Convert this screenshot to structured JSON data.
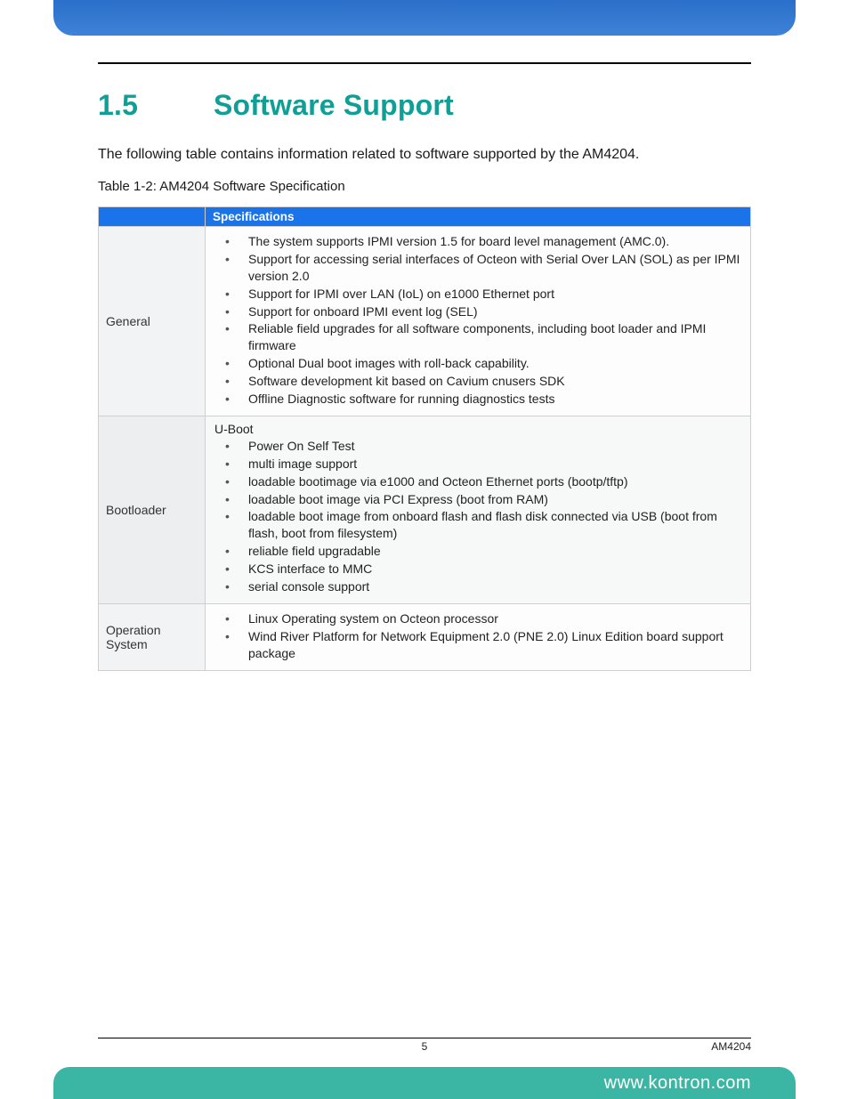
{
  "heading": {
    "number": "1.5",
    "title": "Software Support"
  },
  "intro": "The following table contains information related to software supported by the AM4204.",
  "tableCaption": "Table 1-2: AM4204 Software Specification",
  "table": {
    "header": {
      "col1": "",
      "col2": "Specifications"
    },
    "rows": [
      {
        "category": "General",
        "lead": "",
        "items": [
          "The system supports IPMI version 1.5 for board level management (AMC.0).",
          "Support for accessing serial interfaces of Octeon with Serial Over LAN (SOL) as per IPMI version 2.0",
          "Support for IPMI over LAN (IoL) on e1000 Ethernet port",
          "Support for onboard IPMI event log (SEL)",
          "Reliable field upgrades for all software components, including boot loader and IPMI firmware",
          "Optional Dual boot images with roll-back capability.",
          "Software development kit based on Cavium cnusers SDK",
          "Offline Diagnostic software for running diagnostics tests"
        ]
      },
      {
        "category": "Bootloader",
        "lead": "U-Boot",
        "items": [
          "Power On Self Test",
          "multi image support",
          "loadable bootimage via e1000 and Octeon Ethernet ports (bootp/tftp)",
          "loadable boot image via PCI Express (boot from RAM)",
          "loadable boot image from onboard flash and flash disk connected via USB (boot from flash, boot from filesystem)",
          "reliable field upgradable",
          "KCS interface to MMC",
          "serial console support"
        ]
      },
      {
        "category": "Operation System",
        "lead": "",
        "items": [
          "Linux Operating system on Octeon processor",
          "Wind River Platform for Network Equipment 2.0 (PNE 2.0) Linux Edition board support package"
        ]
      }
    ]
  },
  "footer": {
    "pageNumber": "5",
    "docId": "AM4204",
    "url": "www.kontron.com"
  }
}
